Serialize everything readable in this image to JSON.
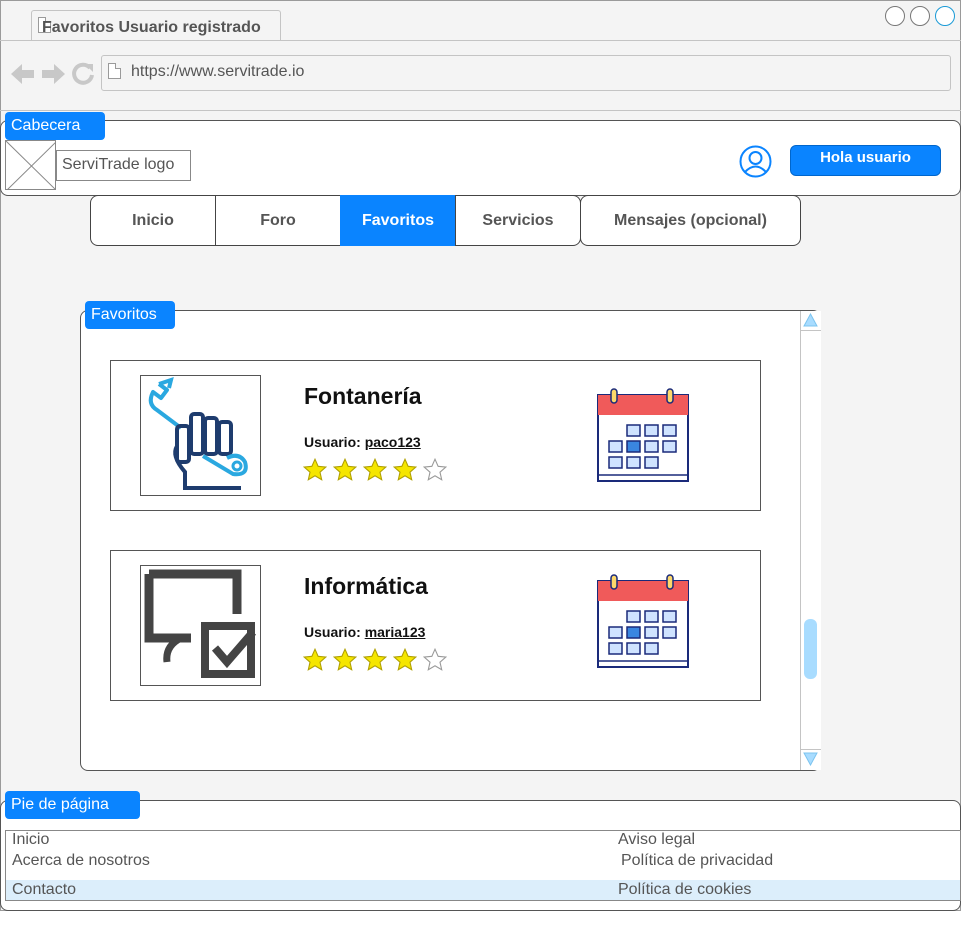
{
  "browser": {
    "tab_title": "Favoritos Usuario registrado",
    "url": "https://www.servitrade.io"
  },
  "header": {
    "section_label": "Cabecera",
    "logo_text": "ServiTrade logo",
    "greeting_button": "Hola usuario"
  },
  "nav": {
    "items": [
      {
        "label": "Inicio",
        "active": false
      },
      {
        "label": "Foro",
        "active": false
      },
      {
        "label": "Favoritos",
        "active": true
      },
      {
        "label": "Servicios",
        "active": false
      },
      {
        "label": "Mensajes (opcional)",
        "active": false
      }
    ]
  },
  "favorites": {
    "section_label": "Favoritos",
    "user_prefix": "Usuario:",
    "items": [
      {
        "title": "Fontanería",
        "username": "paco123",
        "rating": 4,
        "rating_max": 5,
        "icon": "plumbing-wrench-icon"
      },
      {
        "title": "Informática",
        "username": "maria123",
        "rating": 4,
        "rating_max": 5,
        "icon": "computer-check-icon"
      }
    ]
  },
  "footer": {
    "section_label": "Pie de página",
    "links_left": [
      "Inicio",
      "Acerca de nosotros",
      "Contacto"
    ],
    "links_right": [
      "Aviso legal",
      "Política de privacidad",
      "Política de cookies"
    ]
  },
  "colors": {
    "accent": "#0a84ff",
    "star_filled": "#f5e600",
    "calendar_red": "#f05a5a",
    "calendar_blue": "#1a2a7a"
  }
}
